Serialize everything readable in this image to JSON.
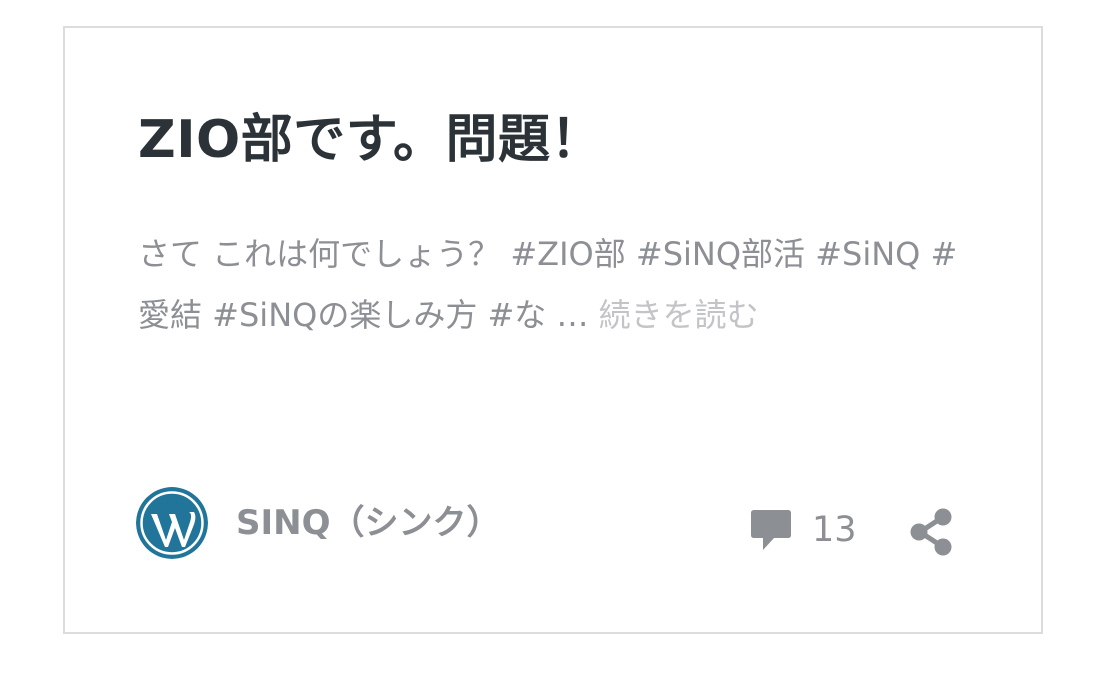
{
  "post": {
    "title": "ZIO部です。問題！",
    "excerpt": "さて これは何でしょう？ #ZIO部 #SiNQ部活 #SiNQ #愛結 #SiNQの楽しみ方 #な … ",
    "read_more": "続きを読む"
  },
  "footer": {
    "author": "SINQ（シンク）",
    "comment_count": "13"
  },
  "icons": {
    "avatar": "wordpress-logo",
    "comments": "comment-bubble-icon",
    "share": "share-icon"
  },
  "colors": {
    "title": "#2c3338",
    "excerpt": "#8c8f94",
    "read_more": "#c3c4c7",
    "meta": "#8c8f94",
    "wordpress_blue": "#21759b",
    "card_border": "#dcdcde"
  }
}
